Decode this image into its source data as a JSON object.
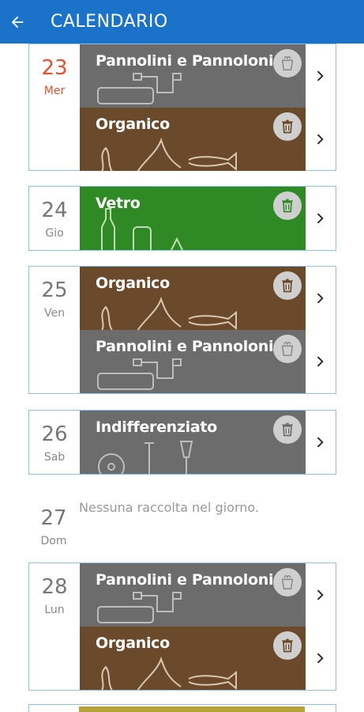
{
  "appbar": {
    "title": "CALENDARIO",
    "back_icon": "arrow-left-icon"
  },
  "days": [
    {
      "num": "23",
      "name": "Mer",
      "today": true,
      "items": [
        {
          "label": "Pannolini e Pannoloni",
          "color": "#6c6c6c",
          "icon": "bag-icon"
        },
        {
          "label": "Organico",
          "color": "#6a4a2a",
          "icon": "trash-icon"
        }
      ]
    },
    {
      "num": "24",
      "name": "Gio",
      "items": [
        {
          "label": "Vetro",
          "color": "#2f8a25",
          "icon": "trash-icon"
        }
      ]
    },
    {
      "num": "25",
      "name": "Ven",
      "items": [
        {
          "label": "Organico",
          "color": "#6a4a2a",
          "icon": "trash-icon"
        },
        {
          "label": "Pannolini e Pannoloni",
          "color": "#6c6c6c",
          "icon": "bag-icon"
        }
      ]
    },
    {
      "num": "26",
      "name": "Sab",
      "items": [
        {
          "label": "Indifferenziato",
          "color": "#6c6c6c",
          "icon": "trash-icon"
        }
      ]
    },
    {
      "num": "27",
      "name": "Dom",
      "empty_text": "Nessuna raccolta nel giorno."
    },
    {
      "num": "28",
      "name": "Lun",
      "items": [
        {
          "label": "Pannolini e Pannoloni",
          "color": "#6c6c6c",
          "icon": "bag-icon"
        },
        {
          "label": "Organico",
          "color": "#6a4a2a",
          "icon": "trash-icon"
        }
      ]
    }
  ],
  "colors": {
    "accent": "#1a73c9",
    "today": "#e5502d",
    "card_border": "#8fc1ea"
  }
}
